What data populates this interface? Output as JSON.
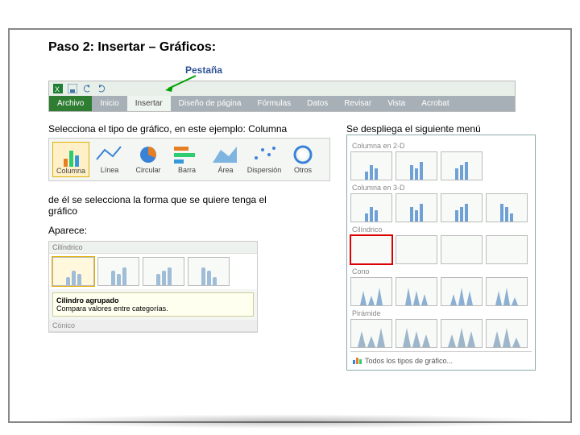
{
  "title": "Paso 2: Insertar – Gráficos:",
  "subtitle": "Pestaña",
  "toolbar": {
    "tabs": {
      "file": "Archivo",
      "home": "Inicio",
      "insert": "Insertar",
      "layout": "Diseño de página",
      "formulas": "Fórmulas",
      "data": "Datos",
      "review": "Revisar",
      "view": "Vista",
      "acrobat": "Acrobat"
    }
  },
  "caption_select": "Selecciona el tipo de gráfico, en este ejemplo: Columna",
  "caption_menu": "Se despliega el siguiente menú",
  "chart_types": {
    "columna": "Columna",
    "linea": "Línea",
    "circular": "Circular",
    "barra": "Barra",
    "area": "Área",
    "dispersion": "Dispersión",
    "otros": "Otros"
  },
  "paragraph_shape": "de él se selecciona la forma que se quiere tenga el gráfico",
  "aparece": "Aparece:",
  "preview": {
    "cat_cil": "Cilíndrico",
    "tip_title": "Cilindro agrupado",
    "tip_desc": "Compara valores entre categorías.",
    "cat_con": "Cónico"
  },
  "menu": {
    "s2d": "Columna en 2-D",
    "s3d": "Columna en 3-D",
    "cil": "Cilíndrico",
    "con": "Cono",
    "pir": "Pirámide",
    "all": "Todos los tipos de gráfico..."
  }
}
